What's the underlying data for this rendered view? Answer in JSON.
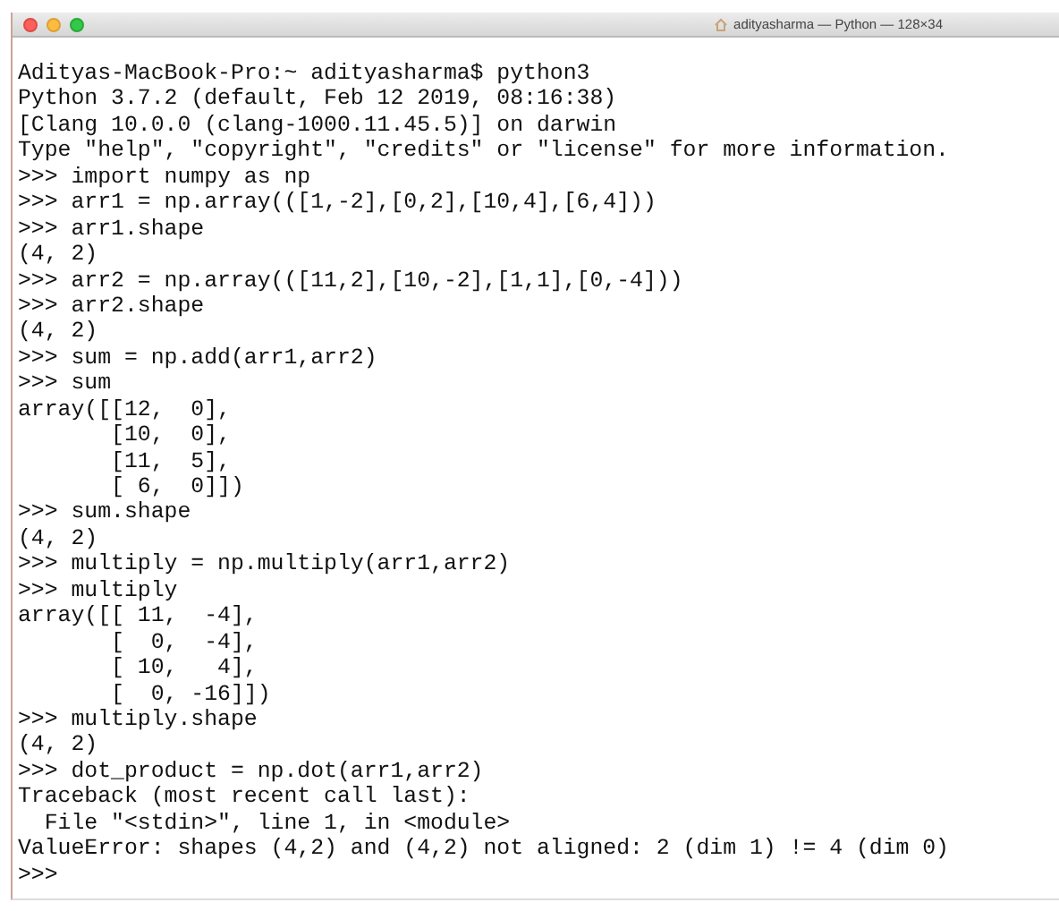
{
  "window": {
    "title": "adityasharma — Python — 128×34"
  },
  "terminal": {
    "lines": [
      "Adityas-MacBook-Pro:~ adityasharma$ python3",
      "Python 3.7.2 (default, Feb 12 2019, 08:16:38)",
      "[Clang 10.0.0 (clang-1000.11.45.5)] on darwin",
      "Type \"help\", \"copyright\", \"credits\" or \"license\" for more information.",
      ">>> import numpy as np",
      ">>> arr1 = np.array(([1,-2],[0,2],[10,4],[6,4]))",
      ">>> arr1.shape",
      "(4, 2)",
      ">>> arr2 = np.array(([11,2],[10,-2],[1,1],[0,-4]))",
      ">>> arr2.shape",
      "(4, 2)",
      ">>> sum = np.add(arr1,arr2)",
      ">>> sum",
      "array([[12,  0],",
      "       [10,  0],",
      "       [11,  5],",
      "       [ 6,  0]])",
      ">>> sum.shape",
      "(4, 2)",
      ">>> multiply = np.multiply(arr1,arr2)",
      ">>> multiply",
      "array([[ 11,  -4],",
      "       [  0,  -4],",
      "       [ 10,   4],",
      "       [  0, -16]])",
      ">>> multiply.shape",
      "(4, 2)",
      ">>> dot_product = np.dot(arr1,arr2)",
      "Traceback (most recent call last):",
      "  File \"<stdin>\", line 1, in <module>",
      "ValueError: shapes (4,2) and (4,2) not aligned: 2 (dim 1) != 4 (dim 0)",
      ">>>"
    ]
  }
}
